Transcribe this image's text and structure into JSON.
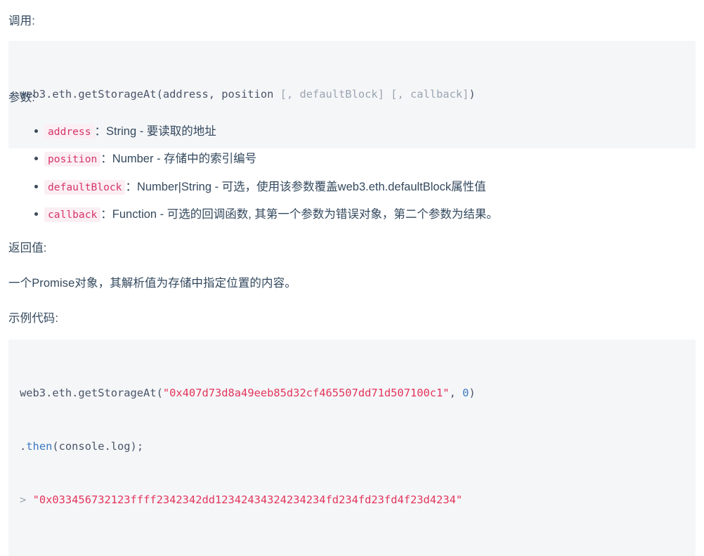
{
  "sections": {
    "call_label": "调用:",
    "params_label": "参数:",
    "returns_label": "返回值:",
    "returns_text": "一个Promise对象，其解析值为存储中指定位置的内容。",
    "example_label": "示例代码:"
  },
  "signature_block": {
    "line1": {
      "fn": "web3.eth.getStorageAt(address, position ",
      "opt1": "[, defaultBlock] ",
      "opt2": "[, callback]",
      "close": ")"
    }
  },
  "parameters": [
    {
      "name": "address",
      "separator": "：",
      "description": "String - 要读取的地址"
    },
    {
      "name": "position",
      "separator": "：",
      "description": "Number - 存储中的索引编号"
    },
    {
      "name": "defaultBlock",
      "separator": "：",
      "description": "Number|String - 可选，使用该参数覆盖web3.eth.defaultBlock属性值"
    },
    {
      "name": "callback",
      "separator": "：",
      "description": "Function - 可选的回调函数, 其第一个参数为错误对象，第二个参数为结果。"
    }
  ],
  "example_block": {
    "line1_call": "web3.eth.getStorageAt(",
    "line1_string": "\"0x407d73d8a49eeb85d32cf465507dd71d507100c1\"",
    "line1_comma": ", ",
    "line1_number": "0",
    "line1_close": ")",
    "line2_dot": ".",
    "line2_fn": "then",
    "line2_rest": "(console.log);",
    "line3_prompt": ">",
    "line3_result": "\"0x033456732123ffff2342342dd12342434324234234fd234fd23fd4f23d4234\""
  },
  "colors": {
    "code_bg": "#f5f6f8",
    "inline_code_bg": "#fbeff3",
    "inline_code_fg": "#d6336c",
    "string_fg": "#e3355b",
    "number_fg": "#3d79c2",
    "text_fg": "#34495e",
    "punct_fg": "#9aa5b1"
  }
}
